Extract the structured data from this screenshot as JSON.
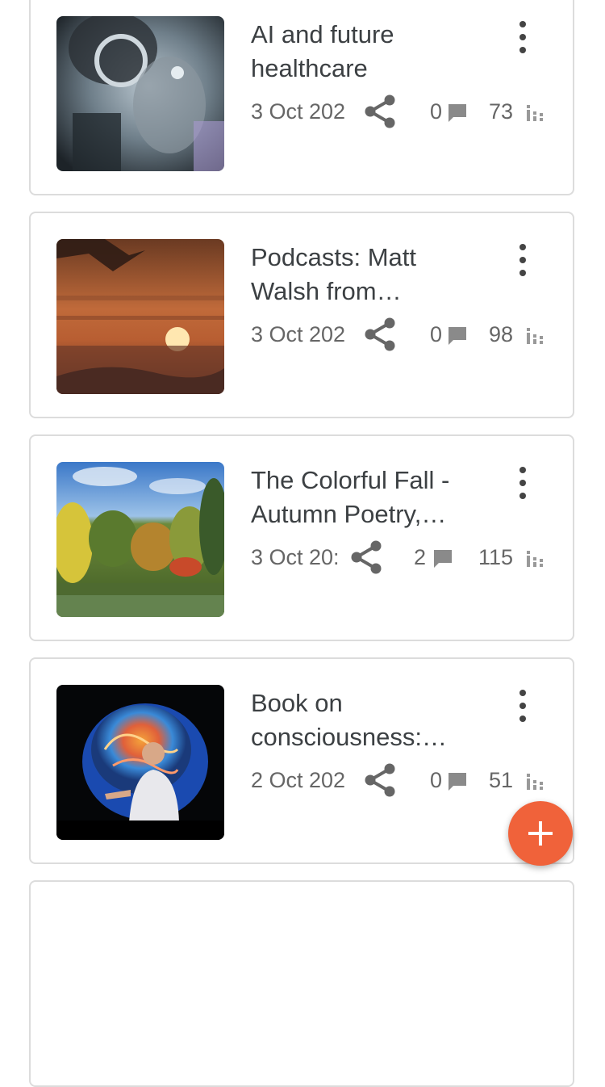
{
  "posts": [
    {
      "title": "AI and future healthcare",
      "date": "3 Oct 202",
      "comments": "0",
      "views": "73",
      "image": "cyborg-portrait-image"
    },
    {
      "title": "Podcasts: Matt Walsh from…",
      "date": "3 Oct 202",
      "comments": "0",
      "views": "98",
      "image": "sunset-image"
    },
    {
      "title": "The Colorful Fall - Autumn Poetry,…",
      "date": "3 Oct 20:",
      "comments": "2",
      "views": "115",
      "image": "autumn-landscape-image"
    },
    {
      "title": "Book on consciousness:…",
      "date": "2 Oct 202",
      "comments": "0",
      "views": "51",
      "image": "speaker-brain-image"
    }
  ],
  "icons": {
    "more": "more-vert-icon",
    "share": "share-icon",
    "comment": "comment-icon",
    "views": "bar-chart-icon",
    "fab": "plus-icon"
  },
  "colors": {
    "fab": "#f0623a",
    "meta_text": "#666666",
    "icon": "#777777",
    "border": "#dcdcdc"
  }
}
